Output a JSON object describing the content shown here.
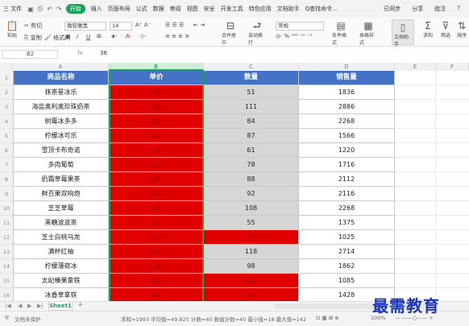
{
  "menubar": {
    "app_menu": "三 文件",
    "quick_icons": [
      "save-icon",
      "print-icon",
      "preview-icon",
      "undo-icon",
      "redo-icon"
    ],
    "items": [
      "开始",
      "插入",
      "页面布局",
      "公式",
      "数据",
      "审阅",
      "视图",
      "安全",
      "开发工具",
      "特色应用",
      "文档助手"
    ],
    "active": "开始",
    "search": "Q查找命令...",
    "right_items": [
      "已同步",
      "分享",
      "批注",
      "?"
    ]
  },
  "ribbon": {
    "cut": "剪切",
    "paste": "粘贴",
    "copy": "复制",
    "format_painter": "格式刷",
    "font_name": "微软雅黑",
    "font_size": "14",
    "bold": "B",
    "italic": "I",
    "underline": "U",
    "merge": "合并居中",
    "wrap": "自动换行",
    "number_style": "常规",
    "cond_format": "条件格式",
    "table_style": "表格样式",
    "doc_assist": "文档助手",
    "sum": "求和",
    "filter": "筛选",
    "sort": "排序"
  },
  "formula_bar": {
    "cell_ref": "B2",
    "fx_label": "fx",
    "value": "36"
  },
  "columns": [
    "A",
    "B",
    "C",
    "D",
    "E",
    "F"
  ],
  "selected_column": "B",
  "rows_numbers": [
    "1",
    "2",
    "3",
    "4",
    "5",
    "6",
    "7",
    "8",
    "9",
    "10",
    "11",
    "12",
    "13",
    "14",
    "15",
    "16"
  ],
  "table": {
    "headers": [
      "商品名称",
      "单价",
      "数量",
      "销售量"
    ],
    "rows": [
      {
        "name": "抹茶星冰乐",
        "price": "36",
        "qty": "51",
        "sales": "1836"
      },
      {
        "name": "海盐奥利奥珍珠奶茶",
        "price": "26",
        "qty": "111",
        "sales": "2886"
      },
      {
        "name": "树莓冰多多",
        "price": "27",
        "qty": "84",
        "sales": "2268"
      },
      {
        "name": "柠檬冰可乐",
        "price": "18",
        "qty": "87",
        "sales": "1566"
      },
      {
        "name": "雪顶卡布奇诺",
        "price": "20",
        "qty": "61",
        "sales": "1220"
      },
      {
        "name": "多肉葡萄",
        "price": "22",
        "qty": "78",
        "sales": "1716"
      },
      {
        "name": "奶霜草莓果茶",
        "price": "24",
        "qty": "88",
        "sales": "2112"
      },
      {
        "name": "鲜百果双响炮",
        "price": "23",
        "qty": "92",
        "sales": "2116"
      },
      {
        "name": "芝芝草莓",
        "price": "21",
        "qty": "108",
        "sales": "2268"
      },
      {
        "name": "黑糖波波茶",
        "price": "25",
        "qty": "55",
        "sales": "1375"
      },
      {
        "name": "芝士白桃乌龙",
        "price": "25",
        "qty": "41",
        "sales": "1025"
      },
      {
        "name": "满杯红柚",
        "price": "23",
        "qty": "118",
        "sales": "2714"
      },
      {
        "name": "柠檬薄荷冰",
        "price": "19",
        "qty": "98",
        "sales": "1862"
      },
      {
        "name": "太妃榛果拿铁",
        "price": "35",
        "qty": "31",
        "sales": "1085"
      },
      {
        "name": "冰香草拿铁",
        "price": "34",
        "qty": "42",
        "sales": "1428"
      }
    ],
    "qty_red_rows": [
      10,
      13,
      14
    ],
    "colors": {
      "header": "#4472c4",
      "red": "#e00000",
      "gray": "#d6d6d6"
    }
  },
  "sheet_tabs": {
    "active": "Sheet1",
    "add": "+"
  },
  "statusbar": {
    "doc_status": "文档未保护",
    "stats": "求和=1993  平均值=49.825  计数=40  数值计数=40  最小值=18  最大值=142",
    "zoom": "100%"
  },
  "watermark": "最需教育"
}
